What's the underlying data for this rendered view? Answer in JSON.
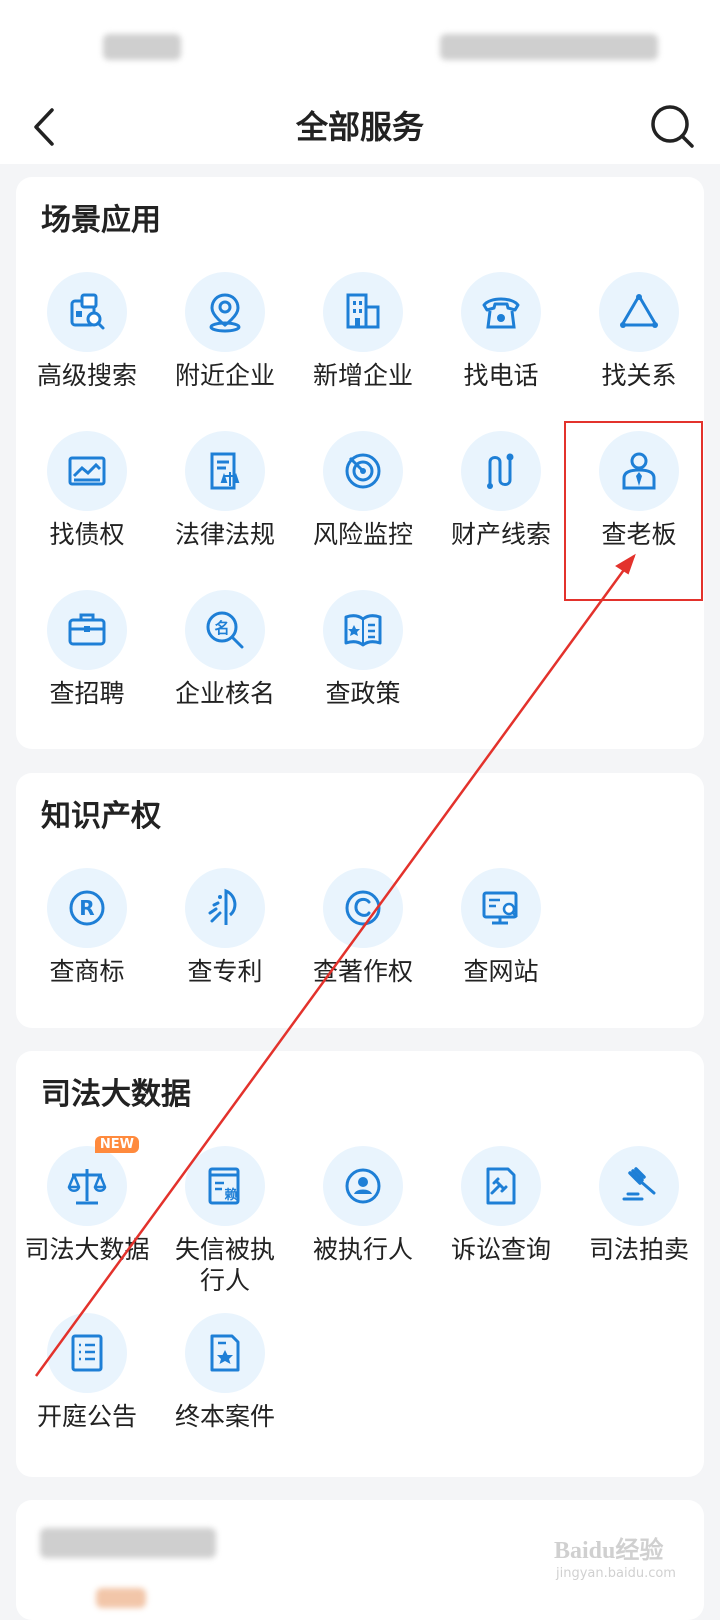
{
  "header": {
    "title": "全部服务",
    "back_icon": "back-chevron-icon",
    "search_icon": "search-icon"
  },
  "colors": {
    "accent": "#1e7fd6",
    "icon_bg": "#e9f4fd",
    "highlight": "#e3322c",
    "badge": "#ff8a3d"
  },
  "sections": [
    {
      "title": "场景应用",
      "items": [
        {
          "label": "高级搜索",
          "icon": "advanced-search-icon"
        },
        {
          "label": "附近企业",
          "icon": "location-pin-icon"
        },
        {
          "label": "新增企业",
          "icon": "building-icon"
        },
        {
          "label": "找电话",
          "icon": "telephone-icon"
        },
        {
          "label": "找关系",
          "icon": "relationship-triangle-icon"
        },
        {
          "label": "找债权",
          "icon": "credit-card-icon"
        },
        {
          "label": "法律法规",
          "icon": "law-document-icon"
        },
        {
          "label": "风险监控",
          "icon": "radar-icon"
        },
        {
          "label": "财产线索",
          "icon": "path-clue-icon"
        },
        {
          "label": "查老板",
          "icon": "boss-person-icon"
        },
        {
          "label": "查招聘",
          "icon": "briefcase-icon"
        },
        {
          "label": "企业核名",
          "icon": "name-search-icon"
        },
        {
          "label": "查政策",
          "icon": "policy-book-icon"
        }
      ]
    },
    {
      "title": "知识产权",
      "items": [
        {
          "label": "查商标",
          "icon": "trademark-icon"
        },
        {
          "label": "查专利",
          "icon": "patent-icon"
        },
        {
          "label": "查著作权",
          "icon": "copyright-icon"
        },
        {
          "label": "查网站",
          "icon": "website-monitor-icon"
        }
      ]
    },
    {
      "title": "司法大数据",
      "badge": "NEW",
      "items": [
        {
          "label": "司法大数据",
          "icon": "justice-scale-icon"
        },
        {
          "label": "失信被执行人",
          "icon": "dishonest-list-icon",
          "char": "赖"
        },
        {
          "label": "被执行人",
          "icon": "person-circle-icon"
        },
        {
          "label": "诉讼查询",
          "icon": "lawsuit-document-icon"
        },
        {
          "label": "司法拍卖",
          "icon": "gavel-icon"
        },
        {
          "label": "开庭公告",
          "icon": "announcement-list-icon"
        },
        {
          "label": "终本案件",
          "icon": "closed-case-icon"
        }
      ]
    }
  ],
  "watermark": {
    "brand": "Baidu经验",
    "sub": "jingyan.baidu.com"
  }
}
